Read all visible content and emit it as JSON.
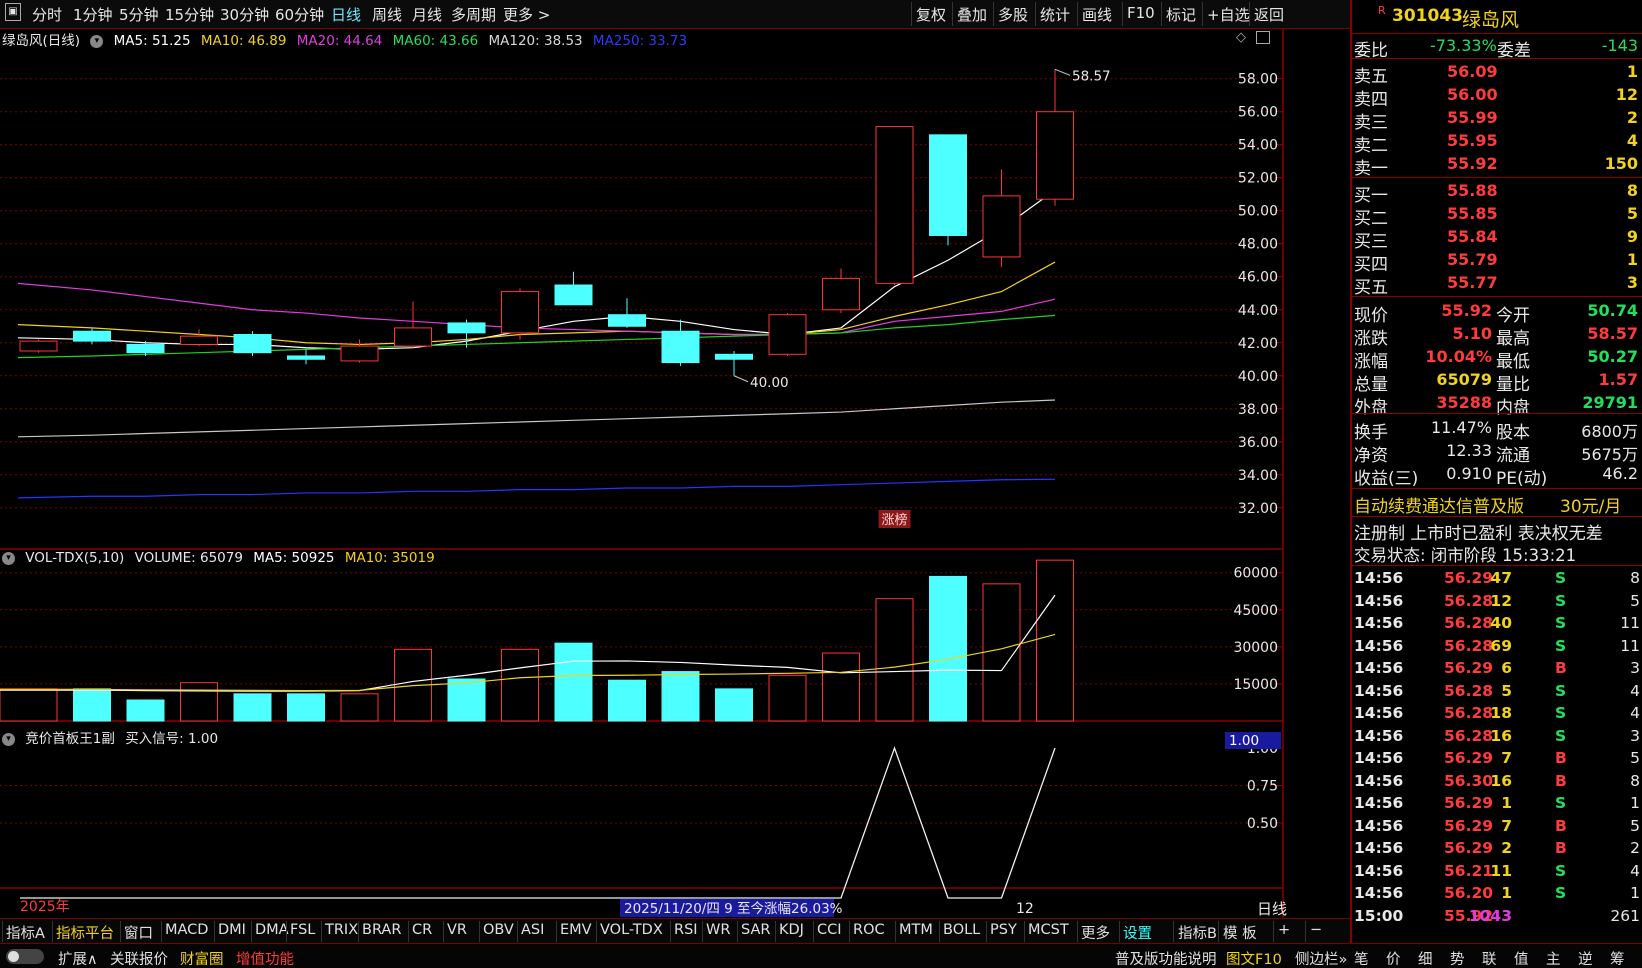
{
  "toolbar": {
    "left": [
      "分时",
      "1分钟",
      "5分钟",
      "15分钟",
      "30分钟",
      "60分钟",
      "日线",
      "周线",
      "月线",
      "多周期",
      "更多 >"
    ],
    "right": [
      "复权",
      "叠加",
      "多股",
      "统计",
      "画线",
      "F10",
      "标记",
      "+自选",
      "返回"
    ]
  },
  "main_legend": {
    "name": "绿岛风(日线)",
    "ma5": "MA5: 51.25",
    "ma10": "MA10: 46.89",
    "ma20": "MA20: 44.64",
    "ma60": "MA60: 43.66",
    "ma120": "MA120: 38.53",
    "ma250": "MA250: 33.73"
  },
  "vol_legend": {
    "name": "VOL-TDX(5,10)",
    "volume": "VOLUME: 65079",
    "ma5": "MA5: 50925",
    "ma10": "MA10: 35019"
  },
  "ind_legend": {
    "name": "竞价首板王1副",
    "signal": "买入信号: 1.00"
  },
  "annotations": {
    "high": "58.57",
    "low": "40.00",
    "limit_tag": "涨榜",
    "year": "2025年",
    "range_info": "2025/11/20/四 9 至今涨幅26.03%",
    "month": "12",
    "period": "日线",
    "ind_value": "1.00"
  },
  "colors": {
    "up": "#ff3333",
    "down": "#4dffff",
    "ma5": "#ffffff",
    "ma10": "#f2d21a",
    "ma20": "#e33ae3",
    "ma60": "#22d022",
    "ma120": "#c8c8c8",
    "ma250": "#2236ff"
  },
  "chart_data": [
    {
      "type": "candlestick",
      "title": "绿岛风(日线)",
      "ylim": [
        31.2,
        59.8
      ],
      "yticks": [
        "58.00",
        "56.00",
        "54.00",
        "52.00",
        "50.00",
        "48.00",
        "46.00",
        "44.00",
        "42.00",
        "40.00",
        "38.00",
        "36.00",
        "34.00",
        "32.00"
      ],
      "candles": [
        {
          "o": 41.5,
          "c": 42.1,
          "h": 42.2,
          "l": 41.4
        },
        {
          "o": 42.7,
          "c": 42.1,
          "h": 42.9,
          "l": 41.9
        },
        {
          "o": 41.9,
          "c": 41.4,
          "h": 42.1,
          "l": 41.2
        },
        {
          "o": 41.9,
          "c": 42.4,
          "h": 42.8,
          "l": 41.8
        },
        {
          "o": 42.5,
          "c": 41.4,
          "h": 42.7,
          "l": 41.2
        },
        {
          "o": 41.2,
          "c": 41.0,
          "h": 41.6,
          "l": 40.7
        },
        {
          "o": 40.9,
          "c": 41.8,
          "h": 42.2,
          "l": 40.8
        },
        {
          "o": 41.8,
          "c": 42.9,
          "h": 44.5,
          "l": 41.7
        },
        {
          "o": 43.2,
          "c": 42.6,
          "h": 43.4,
          "l": 41.7
        },
        {
          "o": 42.6,
          "c": 45.1,
          "h": 45.3,
          "l": 42.2
        },
        {
          "o": 45.5,
          "c": 44.3,
          "h": 46.3,
          "l": 44.3
        },
        {
          "o": 43.7,
          "c": 43.0,
          "h": 44.7,
          "l": 42.9
        },
        {
          "o": 42.7,
          "c": 40.8,
          "h": 43.4,
          "l": 40.6
        },
        {
          "o": 41.3,
          "c": 41.0,
          "h": 41.5,
          "l": 40.0
        },
        {
          "o": 41.3,
          "c": 43.7,
          "h": 43.8,
          "l": 41.2
        },
        {
          "o": 44.0,
          "c": 45.9,
          "h": 46.5,
          "l": 43.8
        },
        {
          "o": 45.6,
          "c": 55.1,
          "h": 55.1,
          "l": 45.5
        },
        {
          "o": 54.6,
          "c": 48.5,
          "h": 54.6,
          "l": 47.9
        },
        {
          "o": 47.2,
          "c": 50.9,
          "h": 52.5,
          "l": 46.6
        },
        {
          "o": 50.7,
          "c": 56.0,
          "h": 58.57,
          "l": 50.3
        }
      ],
      "series": [
        {
          "name": "MA5",
          "values": [
            42.3,
            42.2,
            42.0,
            41.9,
            41.9,
            41.7,
            41.6,
            41.7,
            42.1,
            42.7,
            43.3,
            43.6,
            43.3,
            42.8,
            42.5,
            42.9,
            45.4,
            47.0,
            48.9,
            51.25
          ]
        },
        {
          "name": "MA10",
          "values": [
            43.1,
            42.9,
            42.7,
            42.5,
            42.3,
            42.0,
            41.9,
            42.0,
            42.2,
            42.5,
            42.6,
            42.7,
            42.6,
            42.5,
            42.5,
            42.8,
            43.6,
            44.3,
            45.1,
            46.89
          ]
        },
        {
          "name": "MA20",
          "values": [
            45.6,
            45.2,
            44.8,
            44.4,
            44.0,
            43.8,
            43.5,
            43.3,
            43.1,
            42.9,
            42.8,
            42.7,
            42.6,
            42.5,
            42.5,
            42.6,
            43.3,
            43.6,
            43.9,
            44.64
          ]
        },
        {
          "name": "MA60",
          "values": [
            41.1,
            41.2,
            41.3,
            41.4,
            41.5,
            41.6,
            41.7,
            41.8,
            41.9,
            42.0,
            42.1,
            42.2,
            42.3,
            42.4,
            42.5,
            42.6,
            42.9,
            43.1,
            43.4,
            43.66
          ]
        },
        {
          "name": "MA120",
          "values": [
            36.3,
            36.4,
            36.5,
            36.6,
            36.7,
            36.8,
            36.9,
            37.0,
            37.1,
            37.2,
            37.3,
            37.4,
            37.5,
            37.6,
            37.7,
            37.8,
            38.0,
            38.2,
            38.4,
            38.53
          ]
        },
        {
          "name": "MA250",
          "values": [
            32.6,
            32.7,
            32.7,
            32.8,
            32.8,
            32.9,
            32.9,
            33.0,
            33.0,
            33.1,
            33.1,
            33.2,
            33.2,
            33.3,
            33.3,
            33.4,
            33.5,
            33.6,
            33.7,
            33.73
          ]
        }
      ]
    },
    {
      "type": "bar",
      "title": "VOL-TDX(5,10)",
      "ylim": [
        0,
        70000
      ],
      "yticks": [
        "60000",
        "45000",
        "30000",
        "15000"
      ],
      "values": [
        13000,
        13000,
        8500,
        15500,
        11000,
        11000,
        11000,
        29000,
        17000,
        29000,
        31500,
        16500,
        20000,
        13000,
        18500,
        27500,
        49500,
        58500,
        55500,
        65079
      ],
      "up": [
        true,
        false,
        false,
        true,
        false,
        false,
        true,
        true,
        false,
        true,
        false,
        false,
        false,
        false,
        true,
        true,
        true,
        false,
        true,
        true
      ],
      "series": [
        {
          "name": "MA5",
          "values": [
            12500,
            12500,
            12300,
            12200,
            12100,
            12100,
            12300,
            16000,
            18500,
            21500,
            24200,
            24300,
            23700,
            22600,
            21700,
            19500,
            20000,
            20600,
            20400,
            50925
          ]
        },
        {
          "name": "MA10",
          "values": [
            12800,
            12800,
            12600,
            12500,
            12400,
            12300,
            12400,
            14300,
            15400,
            17500,
            18400,
            18500,
            18800,
            19000,
            19300,
            19700,
            21800,
            25000,
            29200,
            35019
          ]
        }
      ]
    },
    {
      "type": "line",
      "title": "竞价首板王1副",
      "ylim": [
        0,
        1
      ],
      "yticks": [
        "1.00",
        "0.75",
        "0.50"
      ],
      "values": [
        0,
        0,
        0,
        0,
        0,
        0,
        0,
        0,
        0,
        0,
        0,
        0,
        0,
        0,
        0,
        0,
        1,
        0,
        0,
        1
      ]
    }
  ],
  "quote": {
    "code": "301043",
    "name": "绿岛风",
    "wb_label": "委比",
    "wb": "-73.33%",
    "wc_label": "委差",
    "wc": "-143",
    "asks": [
      {
        "l": "卖五",
        "p": "56.09",
        "v": "1"
      },
      {
        "l": "卖四",
        "p": "56.00",
        "v": "12"
      },
      {
        "l": "卖三",
        "p": "55.99",
        "v": "2"
      },
      {
        "l": "卖二",
        "p": "55.95",
        "v": "4"
      },
      {
        "l": "卖一",
        "p": "55.92",
        "v": "150"
      }
    ],
    "bids": [
      {
        "l": "买一",
        "p": "55.88",
        "v": "8"
      },
      {
        "l": "买二",
        "p": "55.85",
        "v": "5"
      },
      {
        "l": "买三",
        "p": "55.84",
        "v": "9"
      },
      {
        "l": "买四",
        "p": "55.79",
        "v": "1"
      },
      {
        "l": "买五",
        "p": "55.77",
        "v": "3"
      }
    ],
    "stats": [
      {
        "a": "现价",
        "av": "55.92",
        "b": "今开",
        "bv": "50.74"
      },
      {
        "a": "涨跌",
        "av": "5.10",
        "b": "最高",
        "bv": "58.57"
      },
      {
        "a": "涨幅",
        "av": "10.04%",
        "b": "最低",
        "bv": "50.27"
      },
      {
        "a": "总量",
        "av": "65079",
        "b": "量比",
        "bv": "1.57"
      },
      {
        "a": "外盘",
        "av": "35288",
        "b": "内盘",
        "bv": "29791"
      }
    ],
    "fin": [
      {
        "a": "换手",
        "av": "11.47%",
        "b": "股本",
        "bv": "6800万"
      },
      {
        "a": "净资",
        "av": "12.33",
        "b": "流通",
        "bv": "5675万"
      },
      {
        "a": "收益(三)",
        "av": "0.910",
        "b": "PE(动)",
        "bv": "46.2"
      }
    ],
    "promo1": "自动续费通达信普及版",
    "promo_price": "30元/月",
    "promo2": "注册制 上市时已盈利 表决权无差",
    "status": "交易状态: 闭市阶段 15:33:21"
  },
  "ticks": [
    [
      "14:56",
      "56.29",
      "47",
      "S",
      "8"
    ],
    [
      "14:56",
      "56.28",
      "12",
      "S",
      "5"
    ],
    [
      "14:56",
      "56.28",
      "40",
      "S",
      "11"
    ],
    [
      "14:56",
      "56.28",
      "69",
      "S",
      "11"
    ],
    [
      "14:56",
      "56.29",
      "6",
      "B",
      "3"
    ],
    [
      "14:56",
      "56.28",
      "5",
      "S",
      "4"
    ],
    [
      "14:56",
      "56.28",
      "18",
      "S",
      "4"
    ],
    [
      "14:56",
      "56.28",
      "16",
      "S",
      "3"
    ],
    [
      "14:56",
      "56.29",
      "7",
      "B",
      "5"
    ],
    [
      "14:56",
      "56.30",
      "16",
      "B",
      "8"
    ],
    [
      "14:56",
      "56.29",
      "1",
      "S",
      "1"
    ],
    [
      "14:56",
      "56.29",
      "7",
      "B",
      "5"
    ],
    [
      "14:56",
      "56.29",
      "2",
      "B",
      "2"
    ],
    [
      "14:56",
      "56.21",
      "11",
      "S",
      "4"
    ],
    [
      "14:56",
      "56.20",
      "1",
      "S",
      "1"
    ],
    [
      "15:00",
      "55.92",
      "1043",
      "",
      "261"
    ]
  ],
  "indicators": [
    "指标A",
    "指标平台",
    "窗口",
    "MACD",
    "DMI",
    "DMA",
    "FSL",
    "TRIX",
    "BRAR",
    "CR",
    "VR",
    "OBV",
    "ASI",
    "EMV",
    "VOL-TDX",
    "RSI",
    "WR",
    "SAR",
    "KDJ",
    "CCI",
    "ROC",
    "MTM",
    "BOLL",
    "PSY",
    "MCST",
    "更多",
    "设置"
  ],
  "indicators_right": [
    "指标B",
    "模 板",
    "+",
    "−"
  ],
  "bottom": {
    "expand": "扩展∧",
    "related": "关联报价",
    "wealth": "财富圈",
    "value_added": "增值功能",
    "edition_note": "普及版功能说明",
    "f10": "图文F10",
    "side": "侧边栏»"
  },
  "right_tabs": [
    "笔",
    "价",
    "细",
    "势",
    "联",
    "值",
    "主",
    "逆",
    "筹"
  ]
}
